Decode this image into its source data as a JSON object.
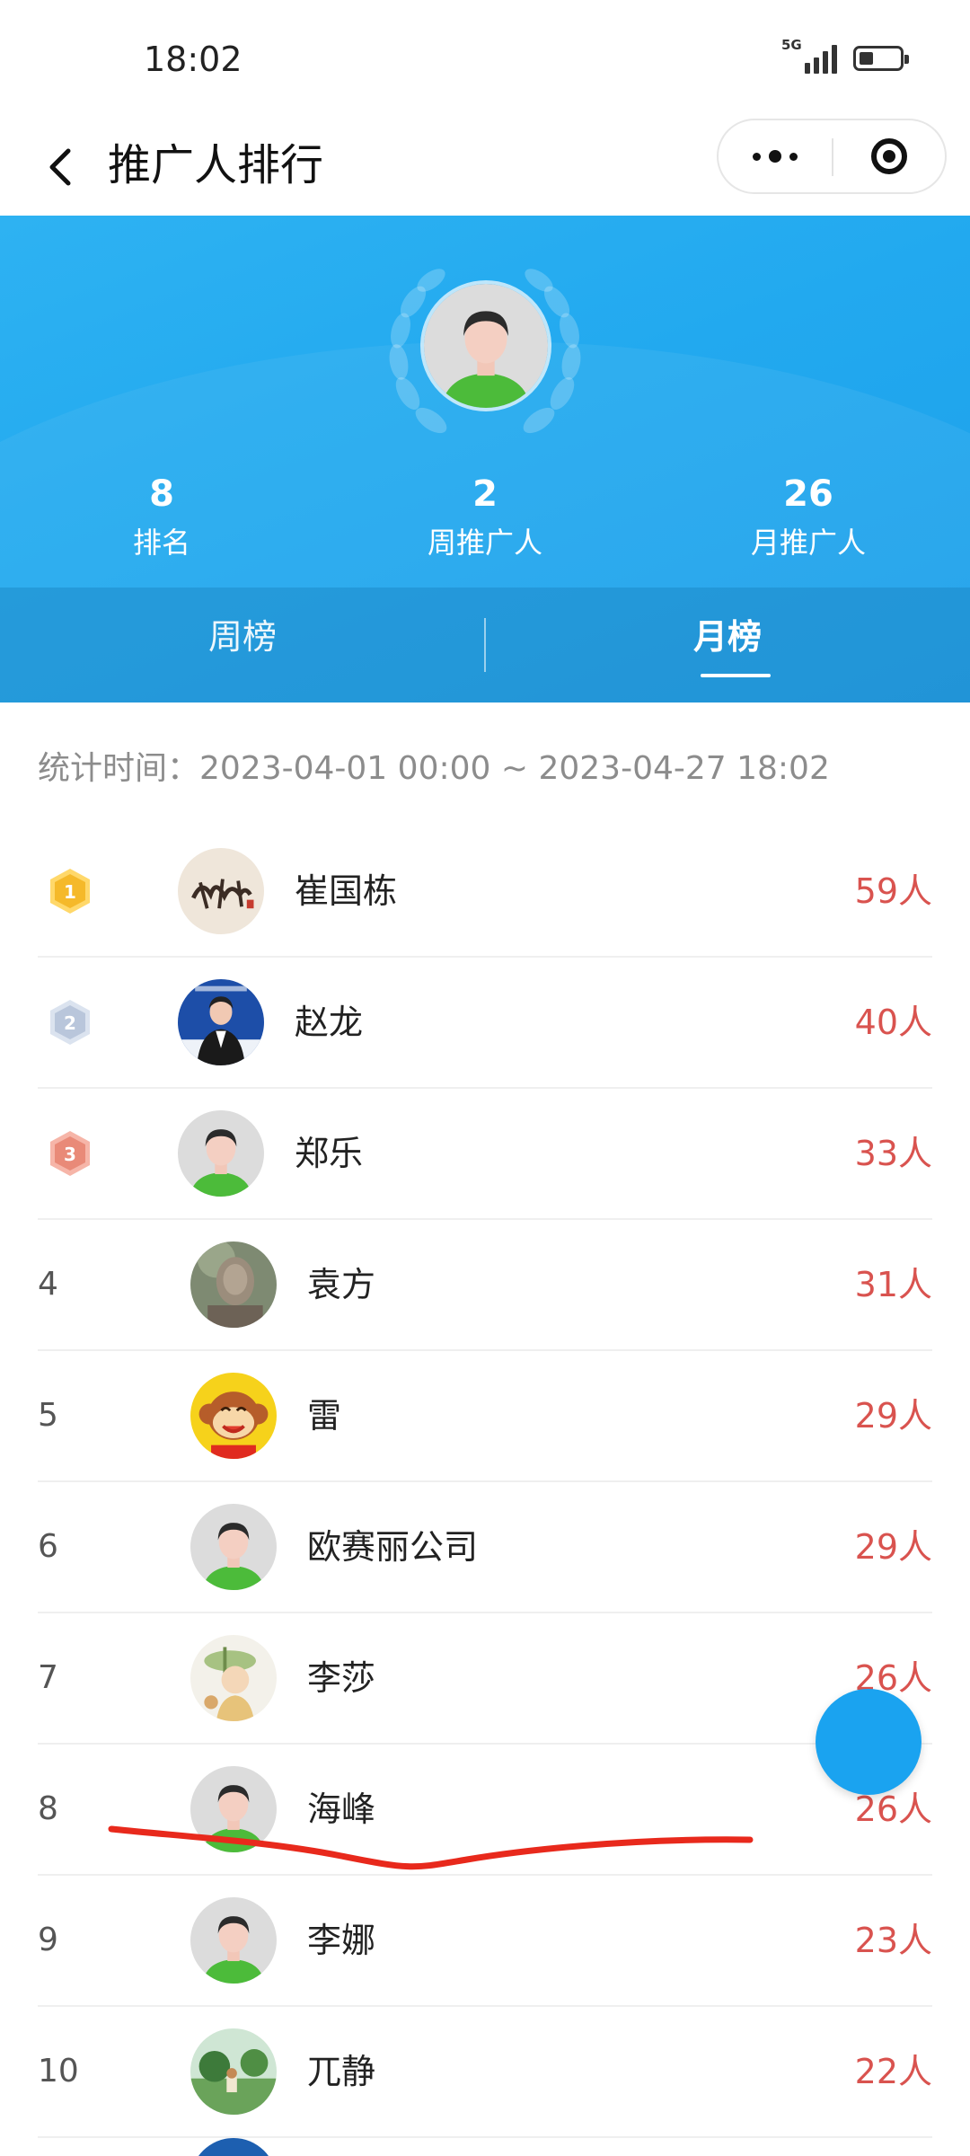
{
  "status_bar": {
    "time": "18:02",
    "network": "5G",
    "battery_level": 0.35
  },
  "nav": {
    "title": "推广人排行",
    "back_icon": "chevron-left-icon",
    "more_icon": "more-dots-icon",
    "close_icon": "target-circle-icon"
  },
  "hero": {
    "stats": [
      {
        "value": "8",
        "label": "排名"
      },
      {
        "value": "2",
        "label": "周推广人"
      },
      {
        "value": "26",
        "label": "月推广人"
      }
    ],
    "tabs": [
      {
        "label": "周榜",
        "active": false
      },
      {
        "label": "月榜",
        "active": true
      }
    ]
  },
  "time_range": "统计时间：2023-04-01 00:00 ~ 2023-04-27 18:02",
  "ranking": [
    {
      "rank": "1",
      "name": "崔国栋",
      "count": "59人",
      "medal": "gold",
      "avatar": "calligraphy"
    },
    {
      "rank": "2",
      "name": "赵龙",
      "count": "40人",
      "medal": "silver",
      "avatar": "photo-blue"
    },
    {
      "rank": "3",
      "name": "郑乐",
      "count": "33人",
      "medal": "bronze",
      "avatar": "default"
    },
    {
      "rank": "4",
      "name": "袁方",
      "count": "31人",
      "medal": "",
      "avatar": "statue"
    },
    {
      "rank": "5",
      "name": "雷",
      "count": "29人",
      "medal": "",
      "avatar": "monkey"
    },
    {
      "rank": "6",
      "name": "欧赛丽公司",
      "count": "29人",
      "medal": "",
      "avatar": "default"
    },
    {
      "rank": "7",
      "name": "李莎",
      "count": "26人",
      "medal": "",
      "avatar": "cartoon"
    },
    {
      "rank": "8",
      "name": "海峰",
      "count": "26人",
      "medal": "",
      "avatar": "default"
    },
    {
      "rank": "9",
      "name": "李娜",
      "count": "23人",
      "medal": "",
      "avatar": "default"
    },
    {
      "rank": "10",
      "name": "兀静",
      "count": "22人",
      "medal": "",
      "avatar": "landscape"
    }
  ],
  "colors": {
    "hero_blue": "#22a9ef",
    "count_red": "#d9534f",
    "fab_blue": "#1aa3f0",
    "annotation_red": "#e8291c"
  }
}
